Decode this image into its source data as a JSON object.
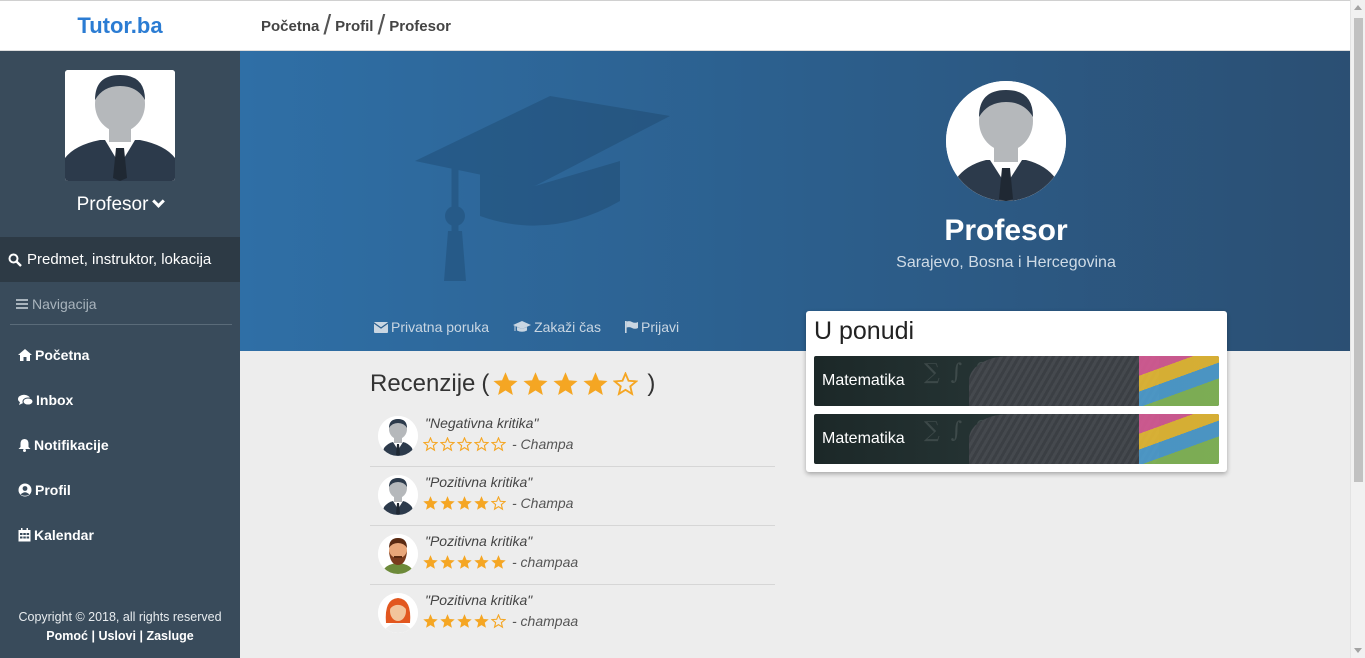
{
  "app": {
    "brand": "Tutor.ba"
  },
  "breadcrumb": [
    "Početna",
    "Profil",
    "Profesor"
  ],
  "sidebar": {
    "user_name": "Profesor",
    "search_placeholder": "Predmet, instruktor, lokacija",
    "nav_heading": "Navigacija",
    "items": [
      {
        "label": "Početna",
        "icon": "home-icon"
      },
      {
        "label": "Inbox",
        "icon": "comments-icon"
      },
      {
        "label": "Notifikacije",
        "icon": "bell-icon"
      },
      {
        "label": "Profil",
        "icon": "user-circle-icon"
      },
      {
        "label": "Kalendar",
        "icon": "calendar-icon"
      }
    ],
    "footer": {
      "copyright": "Copyright © 2018, all rights reserved",
      "links": [
        "Pomoć",
        "Uslovi",
        "Zasluge"
      ],
      "separator": "|"
    }
  },
  "profile": {
    "name": "Profesor",
    "location": "Sarajevo, Bosna i Hercegovina",
    "actions": [
      {
        "label": "Privatna poruka",
        "icon": "envelope-icon"
      },
      {
        "label": "Zakaži čas",
        "icon": "graduation-cap-icon"
      },
      {
        "label": "Prijavi",
        "icon": "flag-icon"
      }
    ]
  },
  "offers": {
    "title": "U ponudi",
    "items": [
      {
        "label": "Matematika"
      },
      {
        "label": "Matematika"
      }
    ]
  },
  "reviews": {
    "title": "Recenzije",
    "rating": 4,
    "max_rating": 5,
    "items": [
      {
        "text": "\"Negativna kritika\"",
        "rating": 0,
        "author": "- Champa",
        "avatar": "male-suit-avatar"
      },
      {
        "text": "\"Pozitivna kritika\"",
        "rating": 4,
        "author": "- Champa",
        "avatar": "male-suit-avatar"
      },
      {
        "text": "\"Pozitivna kritika\"",
        "rating": 5,
        "author": "- champaa",
        "avatar": "bearded-man-avatar"
      },
      {
        "text": "\"Pozitivna kritika\"",
        "rating": 4,
        "author": "- champaa",
        "avatar": "red-hair-woman-avatar"
      }
    ]
  },
  "colors": {
    "brand": "#2b7cd3",
    "sidebar": "#394b5b",
    "sidebar_search": "#2d3a45",
    "hero": "#2c5f8d",
    "star": "#f5a623"
  }
}
